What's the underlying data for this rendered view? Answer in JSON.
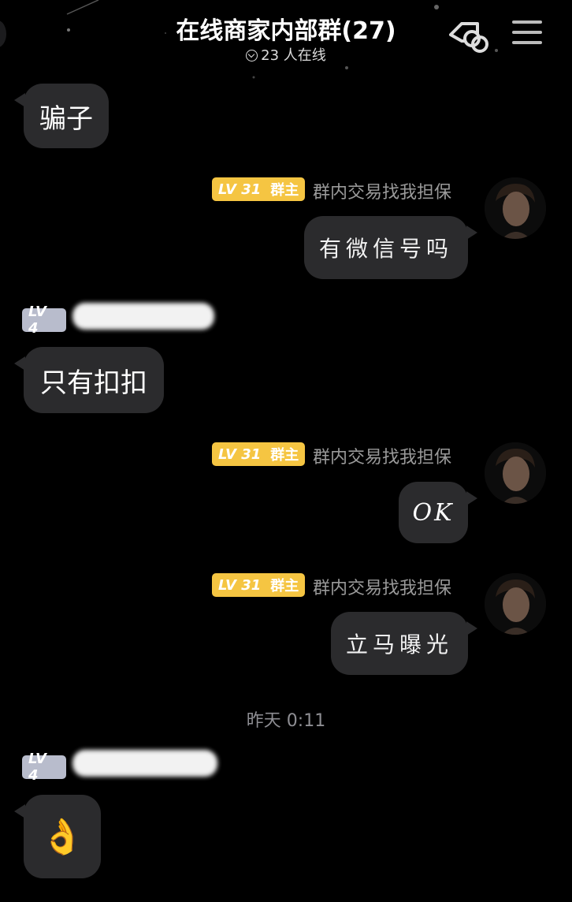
{
  "header": {
    "title": "在线商家内部群(27)",
    "online": "23 人在线"
  },
  "badges": {
    "owner_level": "LV 31",
    "owner_role": "群主",
    "member_level": "LV 4"
  },
  "owner": {
    "nickname": "群内交易找我担保"
  },
  "messages": [
    {
      "side": "left",
      "text": "骗子"
    },
    {
      "side": "right",
      "text": "有微信号吗"
    },
    {
      "side": "left",
      "text": "只有扣扣"
    },
    {
      "side": "right",
      "text": "OK"
    },
    {
      "side": "right",
      "text": "立马曝光"
    },
    {
      "side": "left",
      "text": "👌"
    }
  ],
  "timestamp": "昨天 0:11",
  "colors": {
    "background": "#000000",
    "bubble": "#2b2b2d",
    "owner_badge": "#f5c542",
    "member_badge": "#b8bccc",
    "nickname": "#9a9a9a"
  }
}
